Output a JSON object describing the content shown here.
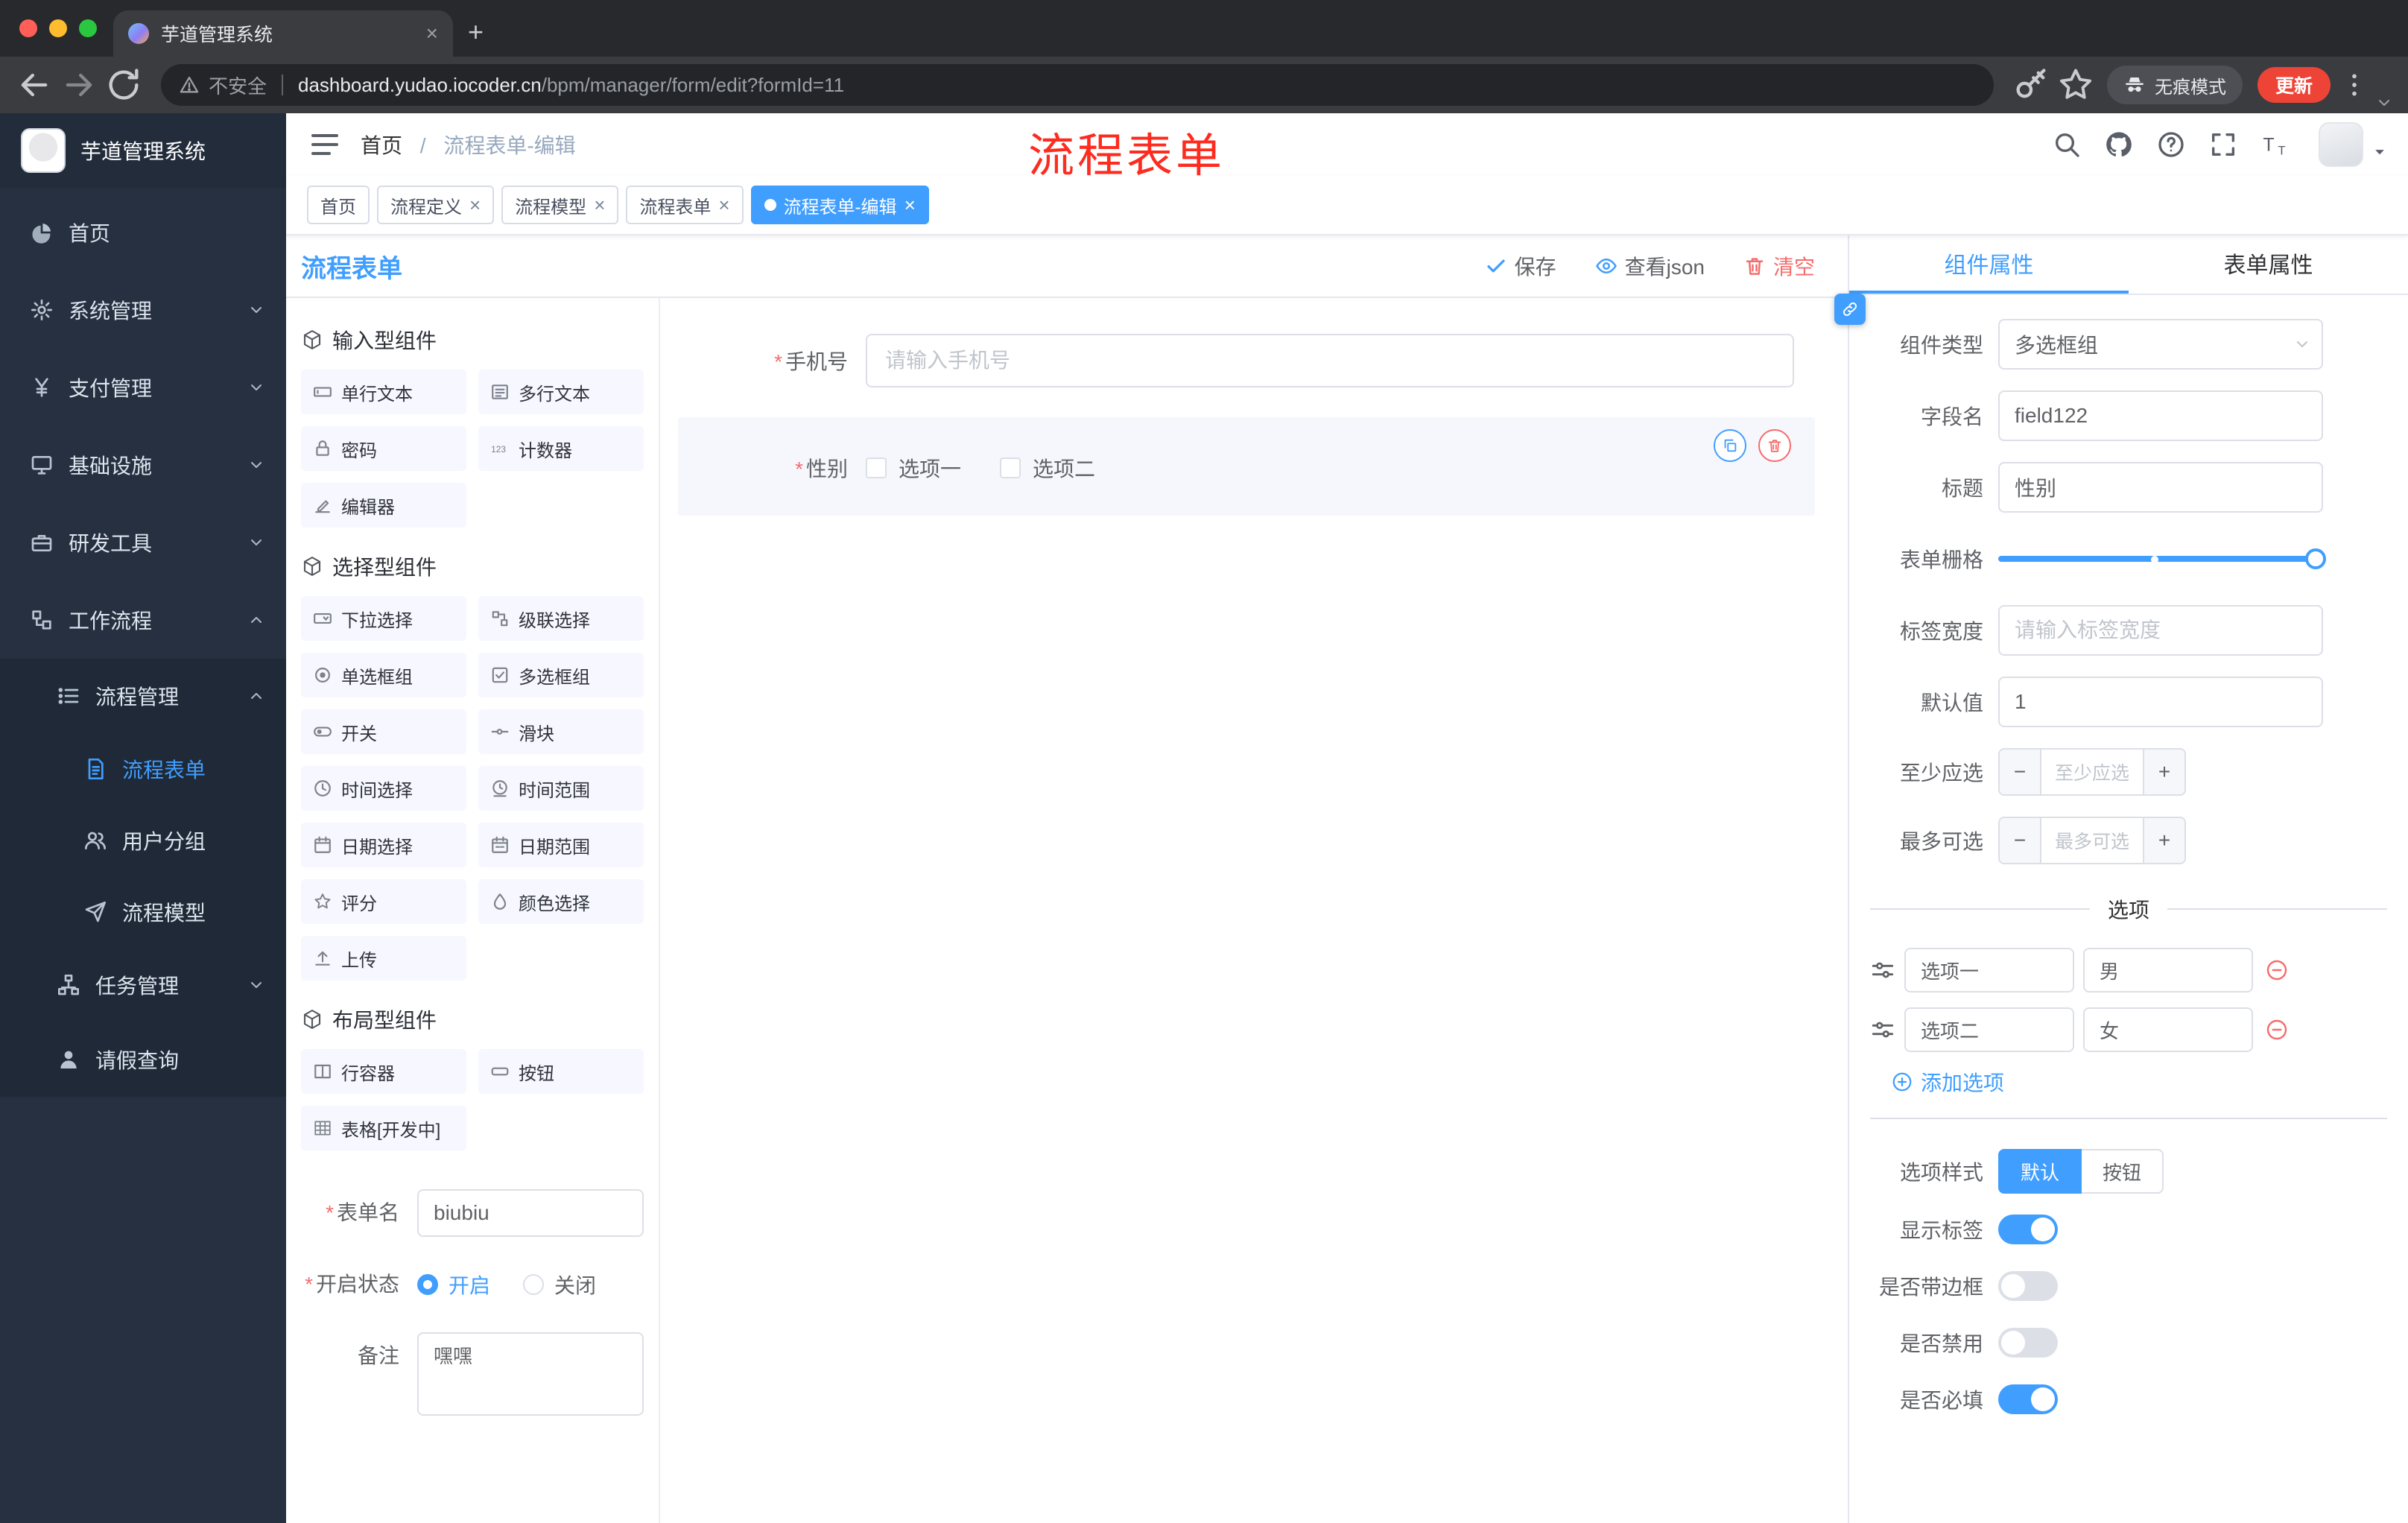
{
  "browser": {
    "tab_title": "芋道管理系统",
    "security_label": "不安全",
    "url_host": "dashboard.yudao.iocoder.cn",
    "url_path": "/bpm/manager/form/edit?formId=11",
    "incognito_label": "无痕模式",
    "update_label": "更新"
  },
  "sidebar": {
    "logo_title": "芋道管理系统",
    "items": [
      {
        "label": "首页",
        "icon": "dashboard",
        "depth": 0
      },
      {
        "label": "系统管理",
        "icon": "gear",
        "depth": 0,
        "chevron": "down"
      },
      {
        "label": "支付管理",
        "icon": "yen",
        "depth": 0,
        "chevron": "down"
      },
      {
        "label": "基础设施",
        "icon": "monitor",
        "depth": 0,
        "chevron": "down"
      },
      {
        "label": "研发工具",
        "icon": "briefcase",
        "depth": 0,
        "chevron": "down"
      },
      {
        "label": "工作流程",
        "icon": "workflow",
        "depth": 0,
        "chevron": "up"
      },
      {
        "label": "流程管理",
        "icon": "list",
        "depth": 1,
        "chevron": "up",
        "sub": true
      },
      {
        "label": "流程表单",
        "icon": "doc",
        "depth": 2,
        "sub": true,
        "active": true
      },
      {
        "label": "用户分组",
        "icon": "users",
        "depth": 2,
        "sub": true
      },
      {
        "label": "流程模型",
        "icon": "send",
        "depth": 2,
        "sub": true
      },
      {
        "label": "任务管理",
        "icon": "tree",
        "depth": 1,
        "chevron": "down",
        "sub": true
      },
      {
        "label": "请假查询",
        "icon": "person",
        "depth": 1,
        "sub": true
      }
    ]
  },
  "header": {
    "breadcrumb_home": "首页",
    "breadcrumb_current": "流程表单-编辑",
    "annotation": "流程表单"
  },
  "tags": [
    {
      "label": "首页",
      "closable": false,
      "active": false
    },
    {
      "label": "流程定义",
      "closable": true,
      "active": false
    },
    {
      "label": "流程模型",
      "closable": true,
      "active": false
    },
    {
      "label": "流程表单",
      "closable": true,
      "active": false
    },
    {
      "label": "流程表单-编辑",
      "closable": true,
      "active": true
    }
  ],
  "designer": {
    "title": "流程表单",
    "actions": {
      "save": "保存",
      "view_json": "查看json",
      "clear": "清空"
    },
    "groups": [
      {
        "title": "输入型组件",
        "items": [
          {
            "label": "单行文本",
            "icon": "input"
          },
          {
            "label": "多行文本",
            "icon": "textarea"
          },
          {
            "label": "密码",
            "icon": "lock"
          },
          {
            "label": "计数器",
            "icon": "counter"
          },
          {
            "label": "编辑器",
            "icon": "editor"
          }
        ]
      },
      {
        "title": "选择型组件",
        "items": [
          {
            "label": "下拉选择",
            "icon": "select"
          },
          {
            "label": "级联选择",
            "icon": "cascader"
          },
          {
            "label": "单选框组",
            "icon": "radio"
          },
          {
            "label": "多选框组",
            "icon": "checkbox"
          },
          {
            "label": "开关",
            "icon": "switch"
          },
          {
            "label": "滑块",
            "icon": "slider"
          },
          {
            "label": "时间选择",
            "icon": "time"
          },
          {
            "label": "时间范围",
            "icon": "timerange"
          },
          {
            "label": "日期选择",
            "icon": "date"
          },
          {
            "label": "日期范围",
            "icon": "daterange"
          },
          {
            "label": "评分",
            "icon": "star"
          },
          {
            "label": "颜色选择",
            "icon": "color"
          },
          {
            "label": "上传",
            "icon": "upload"
          }
        ]
      },
      {
        "title": "布局型组件",
        "items": [
          {
            "label": "行容器",
            "icon": "row"
          },
          {
            "label": "按钮",
            "icon": "button"
          },
          {
            "label": "表格[开发中]",
            "icon": "table"
          }
        ]
      }
    ],
    "meta": {
      "name_label": "表单名",
      "name_value": "biubiu",
      "status_label": "开启状态",
      "status_on": "开启",
      "status_off": "关闭",
      "remark_label": "备注",
      "remark_value": "嘿嘿"
    },
    "canvas": {
      "phone_label": "手机号",
      "phone_placeholder": "请输入手机号",
      "gender_label": "性别",
      "gender_option_1": "选项一",
      "gender_option_2": "选项二"
    }
  },
  "props": {
    "tab_component": "组件属性",
    "tab_form": "表单属性",
    "type_label": "组件类型",
    "type_value": "多选框组",
    "field_label": "字段名",
    "field_value": "field122",
    "title_label": "标题",
    "title_value": "性别",
    "grid_label": "表单栅格",
    "width_label": "标签宽度",
    "width_placeholder": "请输入标签宽度",
    "default_label": "默认值",
    "default_value": "1",
    "min_label": "至少应选",
    "min_placeholder": "至少应选",
    "max_label": "最多可选",
    "max_placeholder": "最多可选",
    "options_title": "选项",
    "option_rows": [
      {
        "label": "选项一",
        "value": "男"
      },
      {
        "label": "选项二",
        "value": "女"
      }
    ],
    "add_option": "添加选项",
    "style_label": "选项样式",
    "style_default": "默认",
    "style_button": "按钮",
    "toggles": [
      {
        "label": "显示标签",
        "on": true
      },
      {
        "label": "是否带边框",
        "on": false
      },
      {
        "label": "是否禁用",
        "on": false
      },
      {
        "label": "是否必填",
        "on": true
      }
    ]
  },
  "colors": {
    "primary": "#409eff",
    "danger": "#f56c6c"
  }
}
